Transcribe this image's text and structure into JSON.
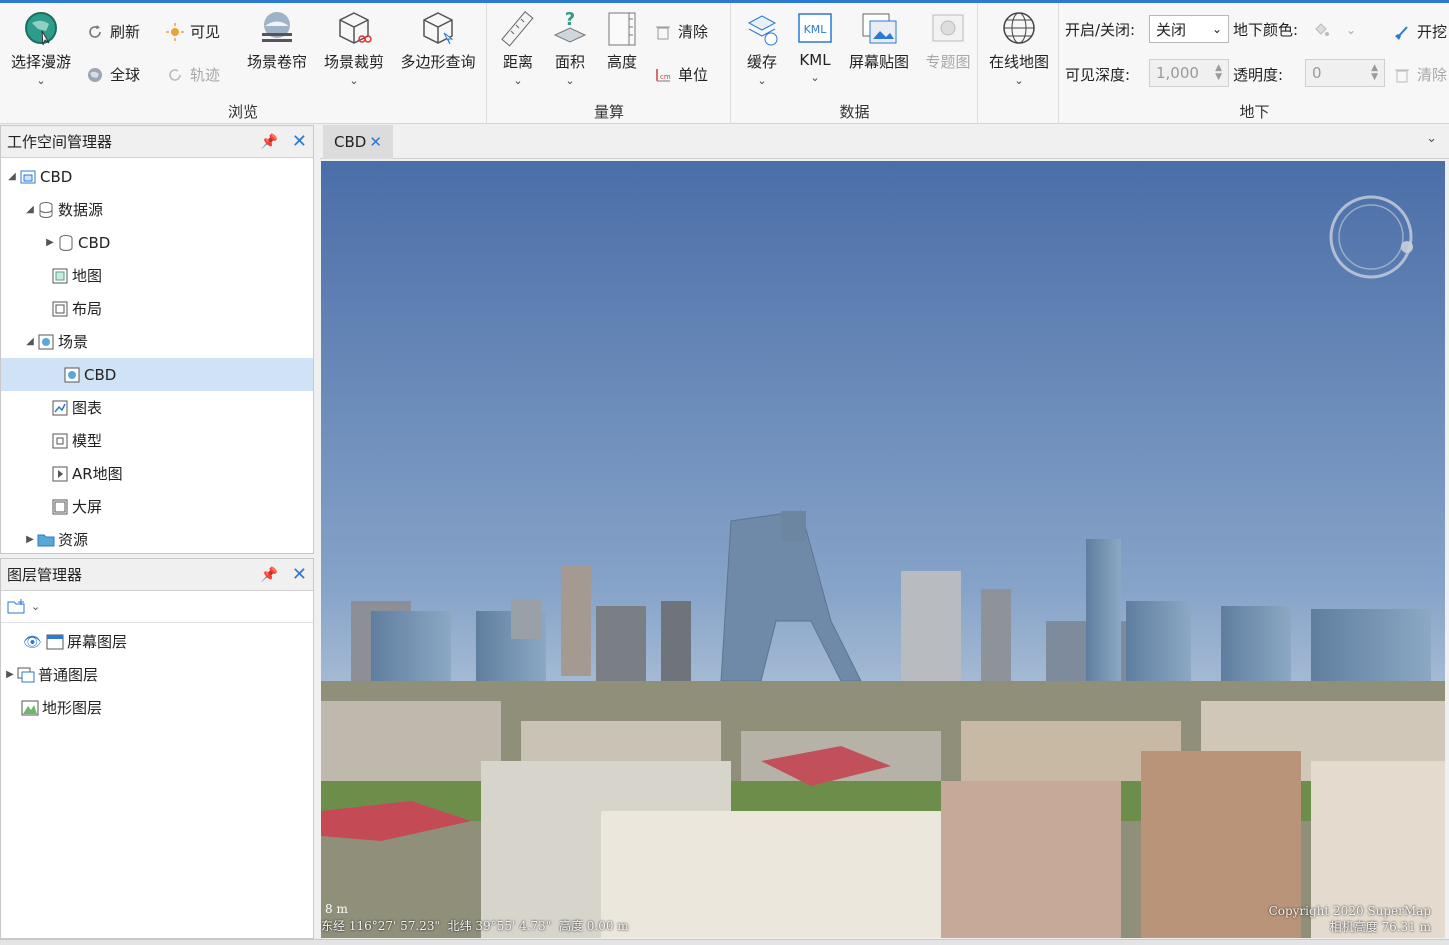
{
  "ribbon": {
    "browse": {
      "label": "浏览",
      "select_roam": "选择漫游",
      "refresh": "刷新",
      "visible": "可见",
      "globe": "全球",
      "track": "轨迹",
      "scene_curtain": "场景卷帘",
      "scene_clip": "场景裁剪",
      "polygon_query": "多边形查询"
    },
    "measure": {
      "label": "量算",
      "distance": "距离",
      "area": "面积",
      "height": "高度",
      "clear": "清除",
      "unit": "单位"
    },
    "data": {
      "label": "数据",
      "cache": "缓存",
      "kml": "KML",
      "kml_icon_text": "KML",
      "screen_overlay": "屏幕贴图",
      "thematic": "专题图",
      "online_map": "在线地图"
    },
    "underground": {
      "label": "地下",
      "onoff_label": "开启/关闭:",
      "onoff_value": "关闭",
      "color_label": "地下颜色:",
      "depth_label": "可见深度:",
      "depth_value": "1,000",
      "opacity_label": "透明度:",
      "opacity_value": "0",
      "dig_label": "开挖",
      "clear_label": "清除"
    }
  },
  "workspace": {
    "title": "工作空间管理器",
    "items": [
      {
        "label": "CBD"
      },
      {
        "label": "数据源"
      },
      {
        "label": "CBD"
      },
      {
        "label": "地图"
      },
      {
        "label": "布局"
      },
      {
        "label": "场景"
      },
      {
        "label": "CBD"
      },
      {
        "label": "图表"
      },
      {
        "label": "模型"
      },
      {
        "label": "AR地图"
      },
      {
        "label": "大屏"
      },
      {
        "label": "资源"
      }
    ]
  },
  "layers": {
    "title": "图层管理器",
    "items": [
      {
        "label": "屏幕图层"
      },
      {
        "label": "普通图层"
      },
      {
        "label": "地形图层"
      }
    ]
  },
  "scene": {
    "tab_label": "CBD",
    "status_line": "东经 116°27' 57.23\"  北纬 39°55' 4.73\"  高度 0.00 m",
    "copyright": "Copyright 2020 SuperMap",
    "camera_height": "相机高度 76.31 m",
    "scale_text": "8 m"
  },
  "colors": {
    "accent": "#2b79d3",
    "selection": "#cfe2f6",
    "sky_top": "#4a6ea8",
    "sky_bottom": "#c9d6e2"
  }
}
